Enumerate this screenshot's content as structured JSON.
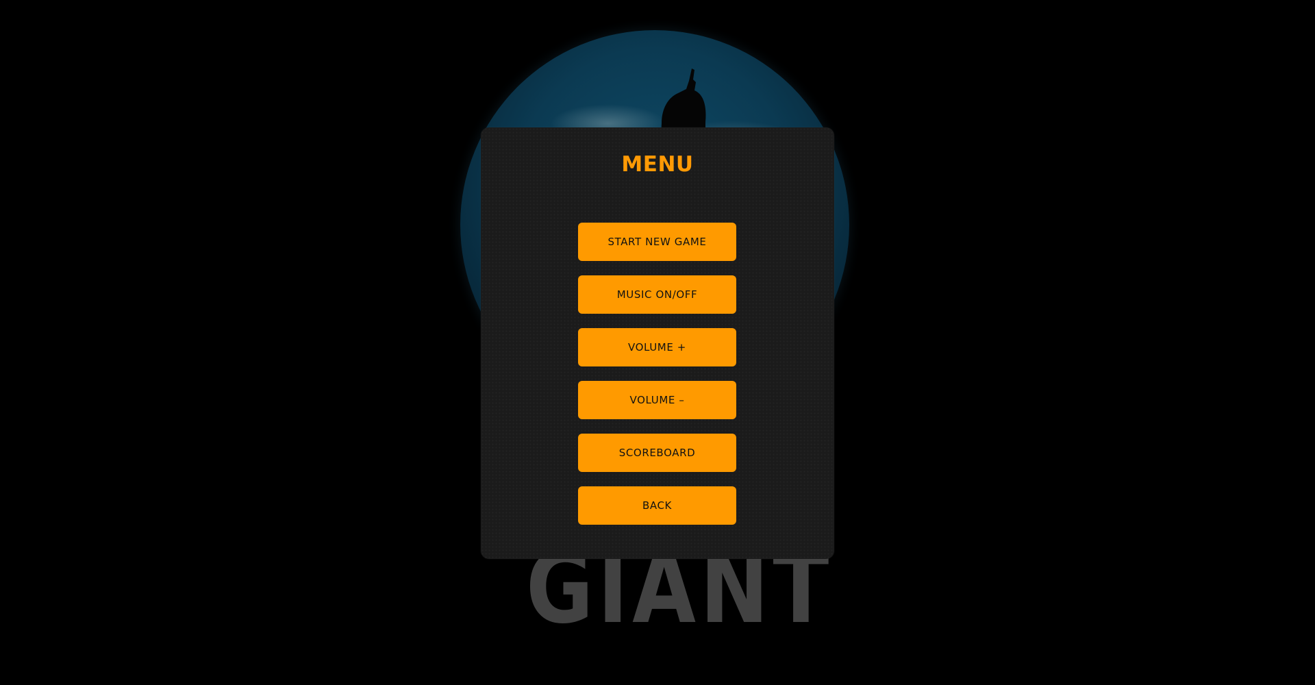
{
  "menu": {
    "title": "MENU",
    "buttons": [
      {
        "label": "START NEW GAME"
      },
      {
        "label": "MUSIC ON/OFF"
      },
      {
        "label": "VOLUME +"
      },
      {
        "label": "VOLUME –"
      },
      {
        "label": "SCOREBOARD"
      },
      {
        "label": "BACK"
      }
    ]
  },
  "background": {
    "logo_text": "GIANT"
  },
  "colors": {
    "accent": "#ff9a00",
    "panel": "#1b1b1b",
    "background": "#000000",
    "planet": "#0b3a52"
  }
}
